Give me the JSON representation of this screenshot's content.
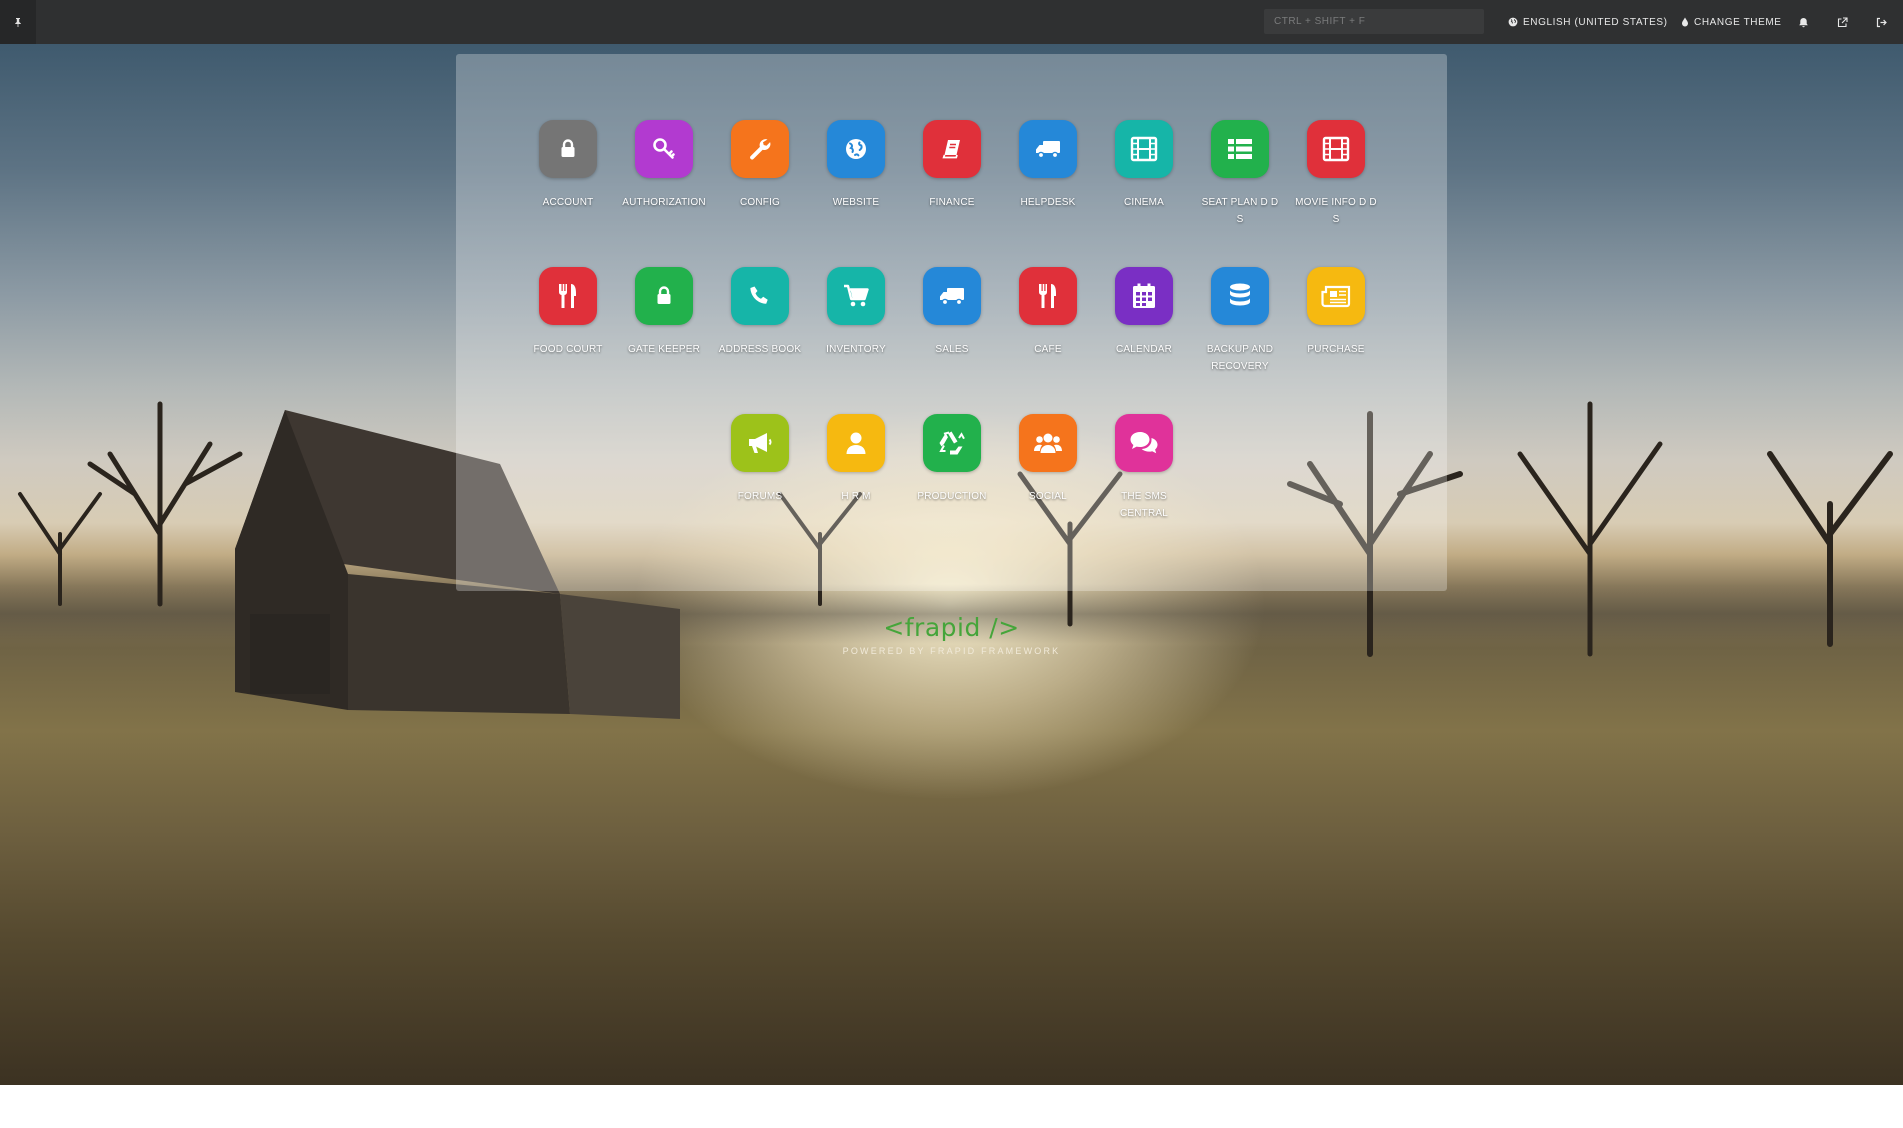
{
  "colors": {
    "topbar_bg": "#2f3031",
    "brand_green": "#45a53a"
  },
  "topbar": {
    "pin_icon": "pin-icon",
    "search_placeholder": "CTRL + SHIFT + F",
    "language_label": "ENGLISH (UNITED STATES)",
    "theme_label": "CHANGE THEME",
    "icons": [
      "globe-icon",
      "drop-icon",
      "bell-icon",
      "external-link-icon",
      "sign-out-icon"
    ]
  },
  "apps": [
    [
      {
        "label": "ACCOUNT",
        "icon": "lock-icon",
        "color": "#757575"
      },
      {
        "label": "AUTHORIZATION",
        "icon": "key-icon",
        "color": "#b23ad0"
      },
      {
        "label": "CONFIG",
        "icon": "wrench-icon",
        "color": "#f5741c"
      },
      {
        "label": "WEBSITE",
        "icon": "globe-icon",
        "color": "#2588d8"
      },
      {
        "label": "FINANCE",
        "icon": "book-icon",
        "color": "#e0303a"
      },
      {
        "label": "HELPDESK",
        "icon": "truck-icon",
        "color": "#2588d8"
      },
      {
        "label": "CINEMA",
        "icon": "film-icon",
        "color": "#16b5a8"
      },
      {
        "label": "SEAT PLAN D D S",
        "icon": "list-icon",
        "color": "#22b14c"
      },
      {
        "label": "MOVIE INFO D D S",
        "icon": "film-icon",
        "color": "#e0303a"
      }
    ],
    [
      {
        "label": "FOOD COURT",
        "icon": "cutlery-icon",
        "color": "#e0303a"
      },
      {
        "label": "GATE KEEPER",
        "icon": "lock-icon",
        "color": "#22b14c"
      },
      {
        "label": "ADDRESS BOOK",
        "icon": "phone-icon",
        "color": "#16b5a8"
      },
      {
        "label": "INVENTORY",
        "icon": "cart-icon",
        "color": "#16b5a8"
      },
      {
        "label": "SALES",
        "icon": "truck-icon",
        "color": "#2588d8"
      },
      {
        "label": "CAFE",
        "icon": "cutlery-icon",
        "color": "#e0303a"
      },
      {
        "label": "CALENDAR",
        "icon": "calendar-icon",
        "color": "#7a2fc4"
      },
      {
        "label": "BACKUP AND RECOVERY",
        "icon": "database-icon",
        "color": "#2588d8"
      },
      {
        "label": "PURCHASE",
        "icon": "newspaper-icon",
        "color": "#f6b910"
      }
    ],
    [
      {
        "label": "FORUMS",
        "icon": "bullhorn-icon",
        "color": "#9dc21a"
      },
      {
        "label": "H R M",
        "icon": "user-icon",
        "color": "#f6b910"
      },
      {
        "label": "PRODUCTION",
        "icon": "recycle-icon",
        "color": "#22b14c"
      },
      {
        "label": "SOCIAL",
        "icon": "users-icon",
        "color": "#f5741c"
      },
      {
        "label": "THE SMS CENTRAL",
        "icon": "comments-icon",
        "color": "#e0329a"
      }
    ]
  ],
  "brand": {
    "logo": "<frapid />",
    "tagline": "POWERED BY FRAPID FRAMEWORK"
  }
}
